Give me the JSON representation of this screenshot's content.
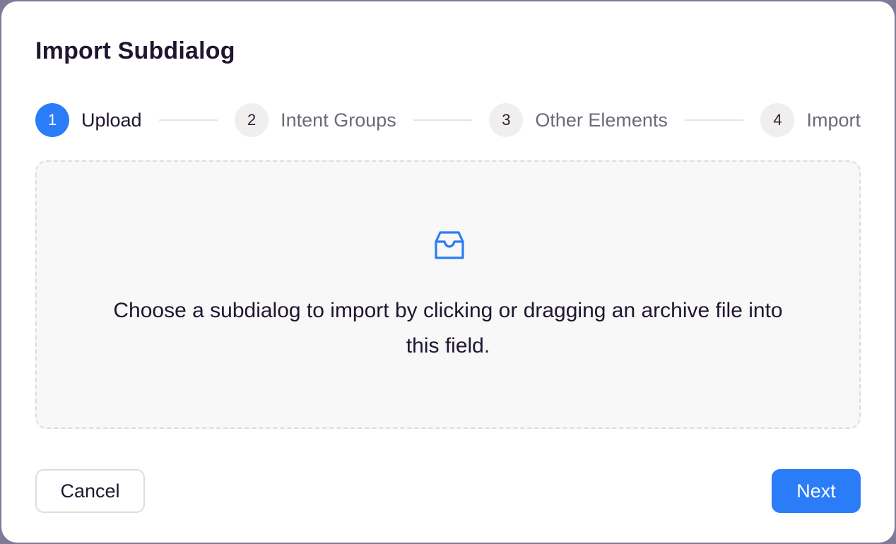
{
  "dialog": {
    "title": "Import Subdialog"
  },
  "steps": [
    {
      "number": "1",
      "label": "Upload",
      "active": true
    },
    {
      "number": "2",
      "label": "Intent Groups",
      "active": false
    },
    {
      "number": "3",
      "label": "Other Elements",
      "active": false
    },
    {
      "number": "4",
      "label": "Import",
      "active": false
    }
  ],
  "dropzone": {
    "icon": "inbox-icon",
    "text": "Choose a subdialog to import by clicking or dragging an archive file into this field."
  },
  "footer": {
    "cancel_label": "Cancel",
    "next_label": "Next"
  },
  "colors": {
    "accent": "#2a7cf8",
    "title": "#1f1530",
    "muted": "#6f6977",
    "dropzone_bg": "#f8f8f8"
  }
}
